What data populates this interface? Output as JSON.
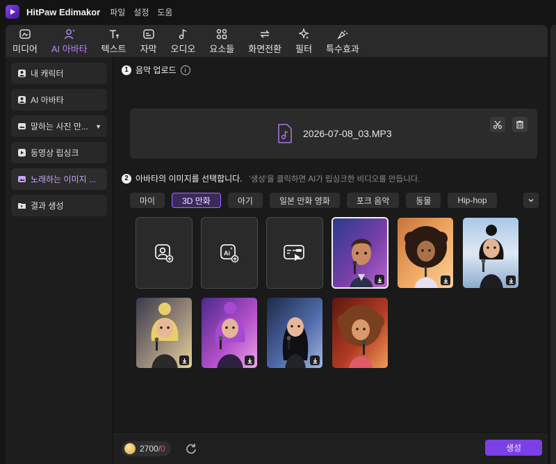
{
  "app": {
    "name": "HitPaw Edimakor",
    "menu": [
      "파일",
      "설정",
      "도움"
    ]
  },
  "tabs": [
    {
      "label": "미디어",
      "icon": "media-icon"
    },
    {
      "label": "AI 아바타",
      "icon": "ai-avatar-icon",
      "active": true
    },
    {
      "label": "텍스트",
      "icon": "text-icon"
    },
    {
      "label": "자막",
      "icon": "subtitle-icon"
    },
    {
      "label": "오디오",
      "icon": "audio-icon"
    },
    {
      "label": "요소들",
      "icon": "elements-icon"
    },
    {
      "label": "화면전환",
      "icon": "transition-icon"
    },
    {
      "label": "필터",
      "icon": "filter-icon"
    },
    {
      "label": "특수효과",
      "icon": "effects-icon"
    }
  ],
  "sidebar": {
    "items": [
      {
        "label": "내 캐릭터",
        "icon": "character-icon"
      },
      {
        "label": "AI 아바타",
        "icon": "avatar-icon"
      },
      {
        "label": "말하는 사진 만...",
        "icon": "photo-icon",
        "has_dropdown": true
      },
      {
        "label": "동영상 립싱크",
        "icon": "video-icon"
      },
      {
        "label": "노래하는 이미지 ...",
        "icon": "singing-image-icon",
        "active": true
      },
      {
        "label": "결과 생성",
        "icon": "result-icon"
      }
    ]
  },
  "step1": {
    "number": "1",
    "title": "음악 업로드",
    "file_name": "2026-07-08_03.MP3"
  },
  "step2": {
    "number": "2",
    "title": "아바타의 이미지를 선택합니다.",
    "hint": "'생성'을 클릭하면 AI가 립싱크한 비디오를 만듭니다."
  },
  "filters": [
    {
      "label": "마이"
    },
    {
      "label": "3D 만화",
      "active": true
    },
    {
      "label": "아기"
    },
    {
      "label": "일본 만화 영화"
    },
    {
      "label": "포크 음악"
    },
    {
      "label": "동물"
    },
    {
      "label": "Hip-hop"
    }
  ],
  "action_cards": [
    {
      "icon": "upload-portrait-icon"
    },
    {
      "icon": "ai-generate-icon"
    },
    {
      "icon": "video-import-icon"
    }
  ],
  "avatars": [
    {
      "name": "avatar-boy-guitar",
      "colors": [
        "#2a3b8f",
        "#7a3fa8",
        "#c06ad6"
      ],
      "selected": true
    },
    {
      "name": "avatar-curly-girl-orange",
      "colors": [
        "#c8743a",
        "#f3b06a",
        "#f6d3a0"
      ]
    },
    {
      "name": "avatar-dark-hair-girl",
      "colors": [
        "#a9c7e6",
        "#dfe9f4",
        "#8aa9cc"
      ]
    },
    {
      "name": "avatar-blonde-girl",
      "colors": [
        "#3a3a4a",
        "#9a8a7a",
        "#e8d79a"
      ]
    },
    {
      "name": "avatar-purple-hair-girl",
      "colors": [
        "#4a2a8a",
        "#b24ec9",
        "#f0a7e8"
      ]
    },
    {
      "name": "avatar-black-hair-girl",
      "colors": [
        "#1e2a4a",
        "#4f6aa8",
        "#a7b9e3"
      ]
    },
    {
      "name": "avatar-curly-girl-red",
      "colors": [
        "#5a1812",
        "#b23a26",
        "#f2a25a"
      ]
    }
  ],
  "footer": {
    "credits": "2700",
    "credits_slash": "/",
    "credits_used": "0",
    "generate_label": "생성"
  },
  "colors": {
    "accent": "#7a40e6",
    "accent_text": "#b784ff"
  }
}
